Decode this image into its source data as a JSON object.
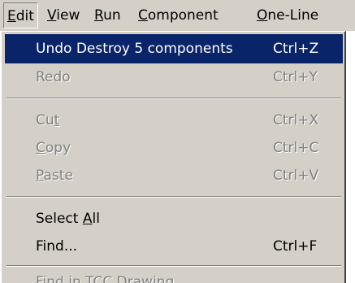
{
  "menubar": {
    "items": [
      {
        "pre": "",
        "mn": "E",
        "post": "dit"
      },
      {
        "pre": "",
        "mn": "V",
        "post": "iew"
      },
      {
        "pre": "",
        "mn": "R",
        "post": "un"
      },
      {
        "pre": "",
        "mn": "C",
        "post": "omponent"
      },
      {
        "pre": "",
        "mn": "O",
        "post": "ne-Line"
      }
    ]
  },
  "menu": {
    "undo": {
      "pre": "Undo Destroy 5 components",
      "mn": "",
      "post": "",
      "shortcut": "Ctrl+Z"
    },
    "redo": {
      "pre": "Redo",
      "mn": "",
      "post": "",
      "shortcut": "Ctrl+Y"
    },
    "cut": {
      "pre": "Cu",
      "mn": "t",
      "post": "",
      "shortcut": "Ctrl+X"
    },
    "copy": {
      "pre": "",
      "mn": "C",
      "post": "opy",
      "shortcut": "Ctrl+C"
    },
    "paste": {
      "pre": "",
      "mn": "P",
      "post": "aste",
      "shortcut": "Ctrl+V"
    },
    "select_all": {
      "pre": "Select ",
      "mn": "A",
      "post": "ll",
      "shortcut": ""
    },
    "find": {
      "pre": "Find...",
      "mn": "",
      "post": "",
      "shortcut": "Ctrl+F"
    },
    "find_tcc": {
      "pre": "",
      "mn": "F",
      "post": "ind in TCC Drawing...",
      "shortcut": ""
    }
  },
  "colors": {
    "menu_bg": "#d4d0c8",
    "highlight_bg": "#0a246a",
    "highlight_text": "#ffffff",
    "disabled_text": "#808080"
  }
}
